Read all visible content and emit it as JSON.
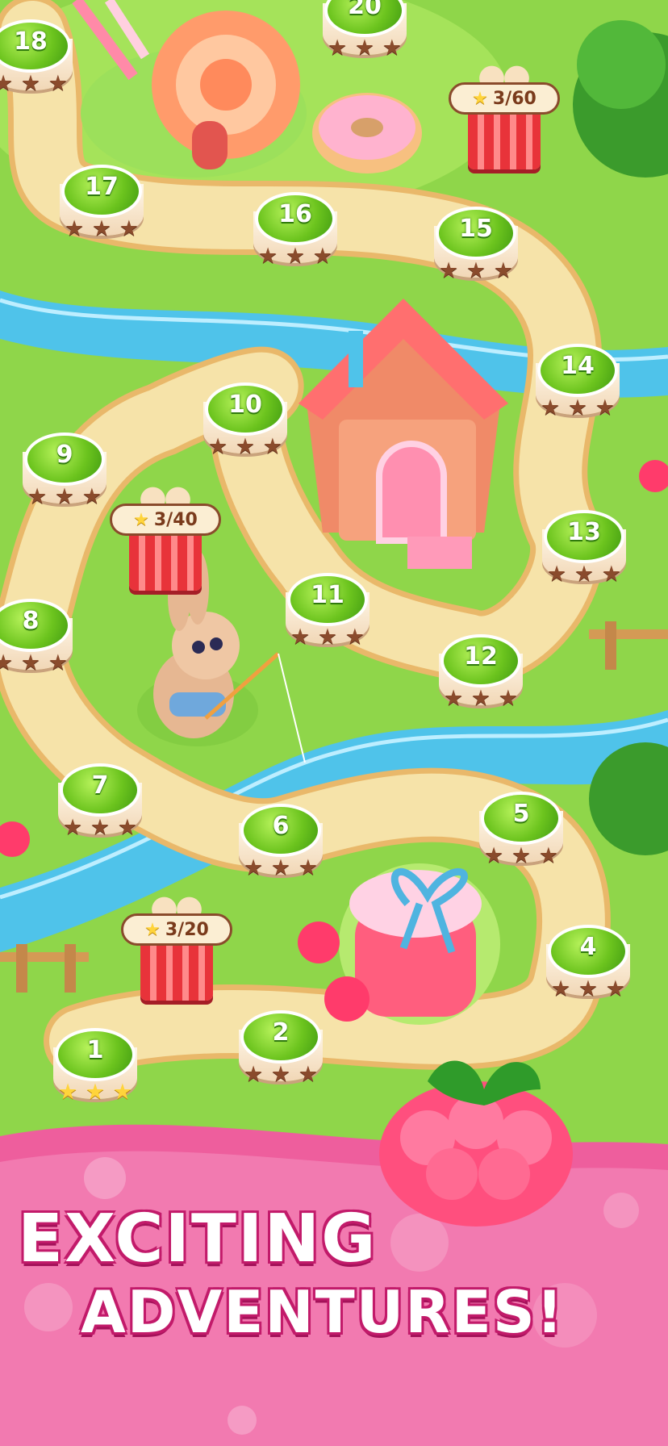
{
  "game": {
    "levels": [
      {
        "number": "1",
        "stars_earned": 3
      },
      {
        "number": "2",
        "stars_earned": 0
      },
      {
        "number": "4",
        "stars_earned": 0
      },
      {
        "number": "5",
        "stars_earned": 0
      },
      {
        "number": "6",
        "stars_earned": 0
      },
      {
        "number": "7",
        "stars_earned": 0
      },
      {
        "number": "8",
        "stars_earned": 0
      },
      {
        "number": "9",
        "stars_earned": 0
      },
      {
        "number": "10",
        "stars_earned": 0
      },
      {
        "number": "11",
        "stars_earned": 0
      },
      {
        "number": "12",
        "stars_earned": 0
      },
      {
        "number": "13",
        "stars_earned": 0
      },
      {
        "number": "14",
        "stars_earned": 0
      },
      {
        "number": "15",
        "stars_earned": 0
      },
      {
        "number": "16",
        "stars_earned": 0
      },
      {
        "number": "17",
        "stars_earned": 0
      },
      {
        "number": "18",
        "stars_earned": 0
      },
      {
        "number": "20",
        "stars_earned": 0
      }
    ],
    "chests": [
      {
        "progress": "3/20"
      },
      {
        "progress": "3/40"
      },
      {
        "progress": "3/60"
      }
    ],
    "star_icon": "star-icon",
    "colors": {
      "level_green": "#6cc41e",
      "star_gold": "#ffd43b",
      "star_empty": "#8a4b2c",
      "banner_pink": "#f0609f",
      "river": "#4fc3ea",
      "path": "#f6e3a9"
    }
  },
  "promo": {
    "line1": "EXCITING",
    "line2": "ADVENTURES!"
  }
}
